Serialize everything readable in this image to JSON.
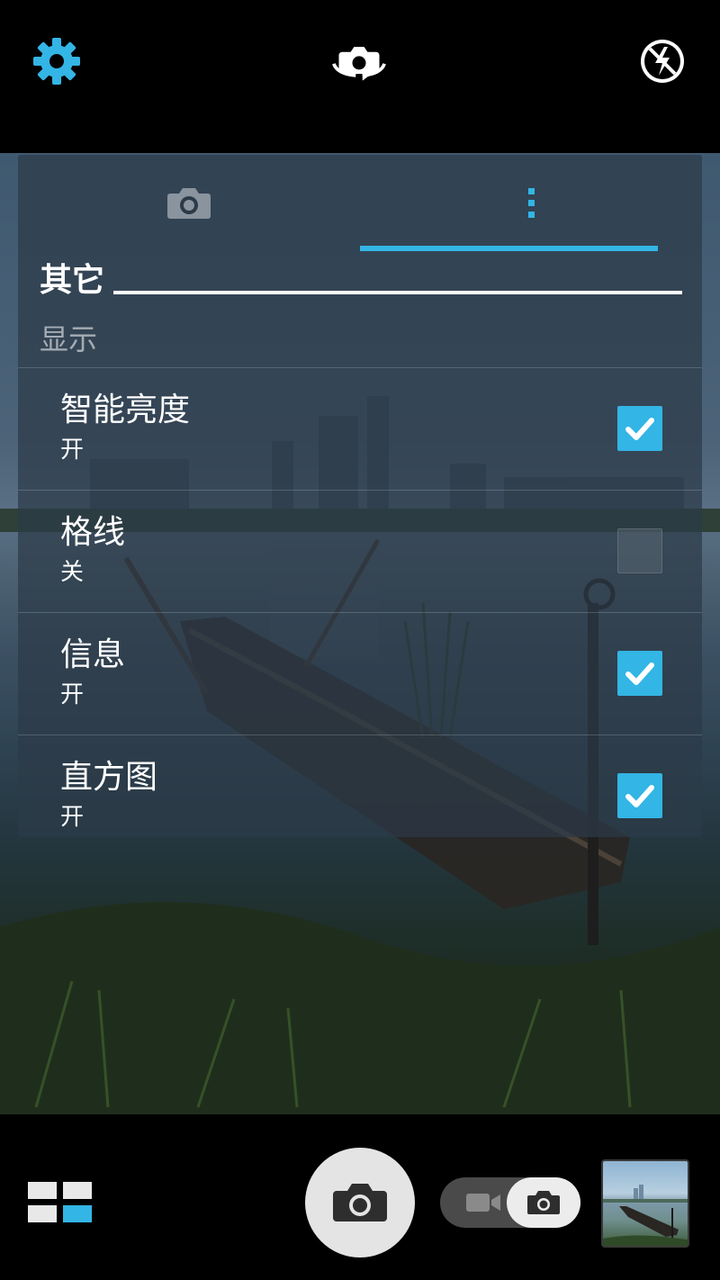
{
  "app": "Camera",
  "top_bar": {
    "settings_icon": "gear-icon",
    "switch_camera_icon": "switch-camera-icon",
    "flash_icon": "flash-off-icon",
    "accent_color": "#33b5e5"
  },
  "panel": {
    "tabs": [
      {
        "icon": "camera-icon",
        "selected": false
      },
      {
        "icon": "more-vertical-icon",
        "selected": true
      }
    ],
    "section_title": "其它",
    "subheader": "显示",
    "items": [
      {
        "title": "智能亮度",
        "value": "开",
        "checked": true
      },
      {
        "title": "格线",
        "value": "关",
        "checked": false
      },
      {
        "title": "信息",
        "value": "开",
        "checked": true
      },
      {
        "title": "直方图",
        "value": "开",
        "checked": true
      }
    ]
  },
  "bottom_bar": {
    "mode_grid_icon": "mode-grid-icon",
    "shutter_icon": "camera-icon",
    "toggle_video_icon": "video-camera-icon",
    "toggle_photo_icon": "camera-icon",
    "selected_mode": "photo",
    "thumbnail": "last-photo-thumbnail"
  }
}
